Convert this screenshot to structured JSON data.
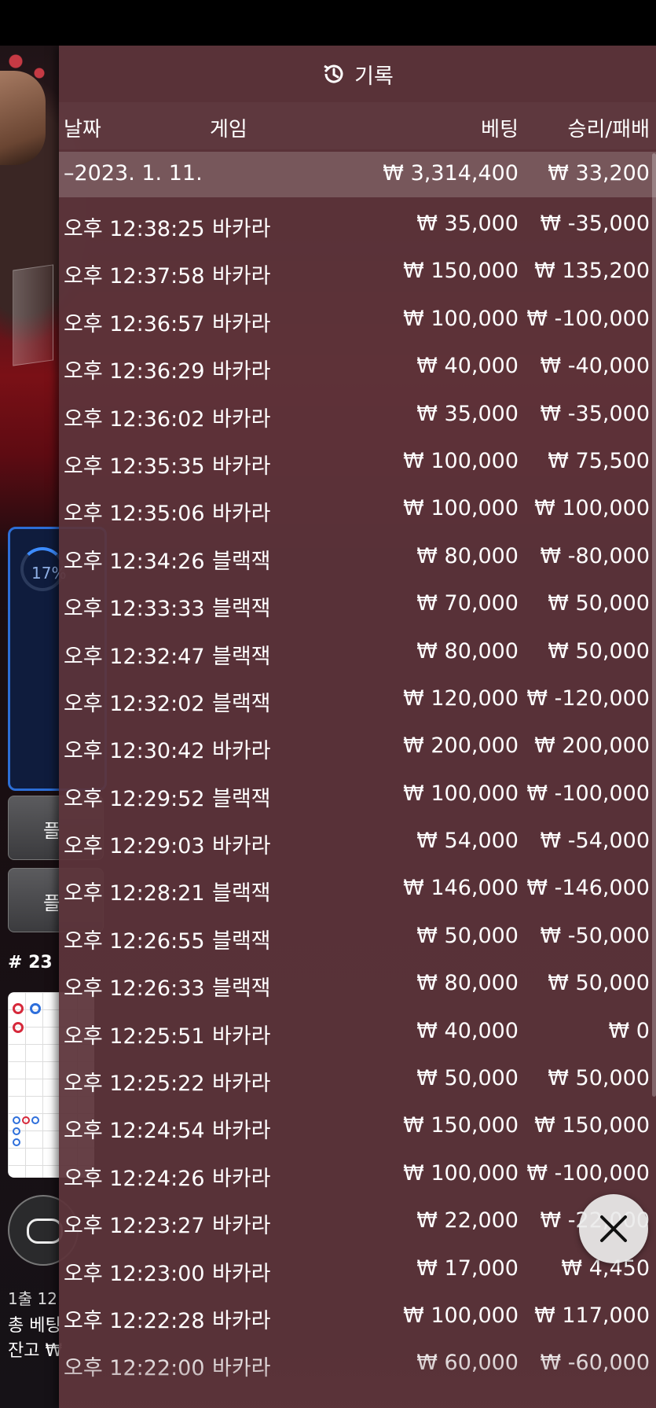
{
  "panel": {
    "title": "기록",
    "title_icon": "history-icon",
    "headers": {
      "date": "날짜",
      "game": "게임",
      "bet": "베팅",
      "result": "승리/패배"
    },
    "summary": {
      "date": "–2023. 1. 11.",
      "bet": "₩ 3,314,400",
      "result": "₩ 33,200"
    },
    "rows": [
      {
        "time": "오후 12:38:25",
        "game": "바카라",
        "bet": "₩ 35,000",
        "result": "₩ -35,000"
      },
      {
        "time": "오후 12:37:58",
        "game": "바카라",
        "bet": "₩ 150,000",
        "result": "₩ 135,200"
      },
      {
        "time": "오후 12:36:57",
        "game": "바카라",
        "bet": "₩ 100,000",
        "result": "₩ -100,000"
      },
      {
        "time": "오후 12:36:29",
        "game": "바카라",
        "bet": "₩ 40,000",
        "result": "₩ -40,000"
      },
      {
        "time": "오후 12:36:02",
        "game": "바카라",
        "bet": "₩ 35,000",
        "result": "₩ -35,000"
      },
      {
        "time": "오후 12:35:35",
        "game": "바카라",
        "bet": "₩ 100,000",
        "result": "₩ 75,500"
      },
      {
        "time": "오후 12:35:06",
        "game": "바카라",
        "bet": "₩ 100,000",
        "result": "₩ 100,000"
      },
      {
        "time": "오후 12:34:26",
        "game": "블랙잭",
        "bet": "₩ 80,000",
        "result": "₩ -80,000"
      },
      {
        "time": "오후 12:33:33",
        "game": "블랙잭",
        "bet": "₩ 70,000",
        "result": "₩ 50,000"
      },
      {
        "time": "오후 12:32:47",
        "game": "블랙잭",
        "bet": "₩ 80,000",
        "result": "₩ 50,000"
      },
      {
        "time": "오후 12:32:02",
        "game": "블랙잭",
        "bet": "₩ 120,000",
        "result": "₩ -120,000"
      },
      {
        "time": "오후 12:30:42",
        "game": "바카라",
        "bet": "₩ 200,000",
        "result": "₩ 200,000"
      },
      {
        "time": "오후 12:29:52",
        "game": "블랙잭",
        "bet": "₩ 100,000",
        "result": "₩ -100,000"
      },
      {
        "time": "오후 12:29:03",
        "game": "바카라",
        "bet": "₩ 54,000",
        "result": "₩ -54,000"
      },
      {
        "time": "오후 12:28:21",
        "game": "블랙잭",
        "bet": "₩ 146,000",
        "result": "₩ -146,000"
      },
      {
        "time": "오후 12:26:55",
        "game": "블랙잭",
        "bet": "₩ 50,000",
        "result": "₩ -50,000"
      },
      {
        "time": "오후 12:26:33",
        "game": "블랙잭",
        "bet": "₩ 80,000",
        "result": "₩ 50,000"
      },
      {
        "time": "오후 12:25:51",
        "game": "바카라",
        "bet": "₩ 40,000",
        "result": "₩ 0"
      },
      {
        "time": "오후 12:25:22",
        "game": "바카라",
        "bet": "₩ 50,000",
        "result": "₩ 50,000"
      },
      {
        "time": "오후 12:24:54",
        "game": "바카라",
        "bet": "₩ 150,000",
        "result": "₩ 150,000"
      },
      {
        "time": "오후 12:24:26",
        "game": "바카라",
        "bet": "₩ 100,000",
        "result": "₩ -100,000"
      },
      {
        "time": "오후 12:23:27",
        "game": "바카라",
        "bet": "₩ 22,000",
        "result": "₩ -22,000"
      },
      {
        "time": "오후 12:23:00",
        "game": "바카라",
        "bet": "₩ 17,000",
        "result": "₩ 4,450"
      },
      {
        "time": "오후 12:22:28",
        "game": "바카라",
        "bet": "₩ 100,000",
        "result": "₩ 117,000"
      },
      {
        "time": "오후 12:22:00",
        "game": "바카라",
        "bet": "₩ 60,000",
        "result": "₩ -60,000"
      }
    ],
    "close_icon": "close-icon"
  },
  "background": {
    "progress_percent": "17%",
    "table_number": "# 23",
    "side_button_1": "플",
    "side_button_2": "플",
    "line1": "1출 12",
    "line2": "총 베팅",
    "line3": "잔고 ₩"
  },
  "colors": {
    "panel_bg": "#5c343a",
    "summary_bg": "#8a6a70",
    "progress_accent": "#3d8cff"
  }
}
